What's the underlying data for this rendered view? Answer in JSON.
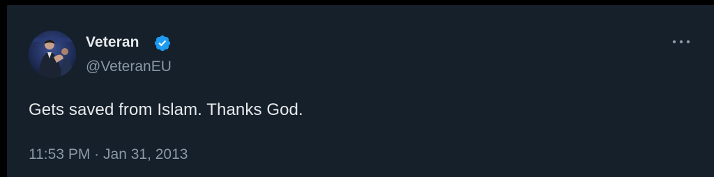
{
  "tweet": {
    "author": {
      "display_name": "Veteran",
      "handle": "@VeteranEU",
      "verified": true
    },
    "text": "Gets saved from Islam. Thanks God.",
    "time": "11:53 PM",
    "separator": "·",
    "date": "Jan 31, 2013"
  },
  "icons": {
    "avatar": "profile-photo",
    "verified": "verified-badge-icon",
    "more": "more-options-icon"
  },
  "colors": {
    "background": "#15202b",
    "primary_text": "#e7e9ea",
    "secondary_text": "#8b98a5",
    "verified_badge": "#1d9bf0"
  }
}
